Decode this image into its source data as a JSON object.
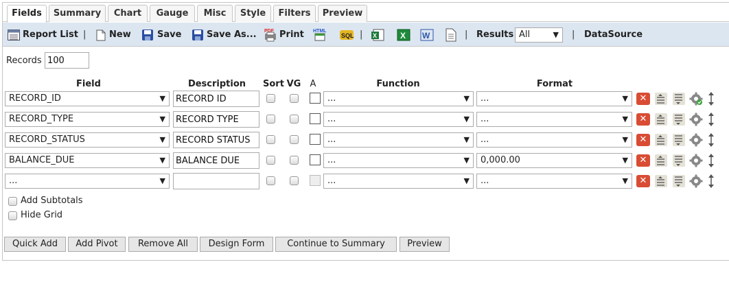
{
  "tabs": [
    "Fields",
    "Summary",
    "Chart",
    "Gauge",
    "Misc",
    "Style",
    "Filters",
    "Preview"
  ],
  "toolbar": {
    "report_list": "Report List",
    "new": "New",
    "save": "Save",
    "save_as": "Save As...",
    "print": "Print",
    "results_label": "Results",
    "results_value": "All",
    "datasource": "DataSource",
    "separator": "|"
  },
  "records": {
    "label": "Records",
    "value": "100"
  },
  "columns": {
    "field": "Field",
    "description": "Description",
    "sort": "Sort",
    "vg": "VG",
    "a": "A",
    "function": "Function",
    "format": "Format"
  },
  "rows": [
    {
      "field": "RECORD_ID",
      "description": "RECORD ID",
      "function": "...",
      "format": "..."
    },
    {
      "field": "RECORD_TYPE",
      "description": "RECORD TYPE",
      "function": "...",
      "format": "..."
    },
    {
      "field": "RECORD_STATUS",
      "description": "RECORD STATUS",
      "function": "...",
      "format": "..."
    },
    {
      "field": "BALANCE_DUE",
      "description": "BALANCE DUE",
      "function": "...",
      "format": "0,000.00"
    },
    {
      "field": "...",
      "description": "",
      "function": "...",
      "format": "..."
    }
  ],
  "options": {
    "add_subtotals": "Add Subtotals",
    "hide_grid": "Hide Grid"
  },
  "buttons": {
    "quick_add": "Quick Add",
    "add_pivot": "Add Pivot",
    "remove_all": "Remove All",
    "design_form": "Design Form",
    "continue": "Continue to Summary",
    "preview": "Preview"
  },
  "colors": {
    "toolbar_bg": "#dce6f1",
    "delete_red": "#d94c34",
    "button_bg": "#e6e6e6"
  },
  "icons": {
    "report_list": "report-list-icon",
    "new": "new-document-icon",
    "save": "floppy-icon",
    "save_as": "floppy-icon",
    "print": "pdf-print-icon",
    "html": "html-icon",
    "sql": "sql-icon",
    "excel1": "excel-icon",
    "excel2": "excel-icon",
    "word": "word-icon",
    "text": "text-document-icon"
  }
}
